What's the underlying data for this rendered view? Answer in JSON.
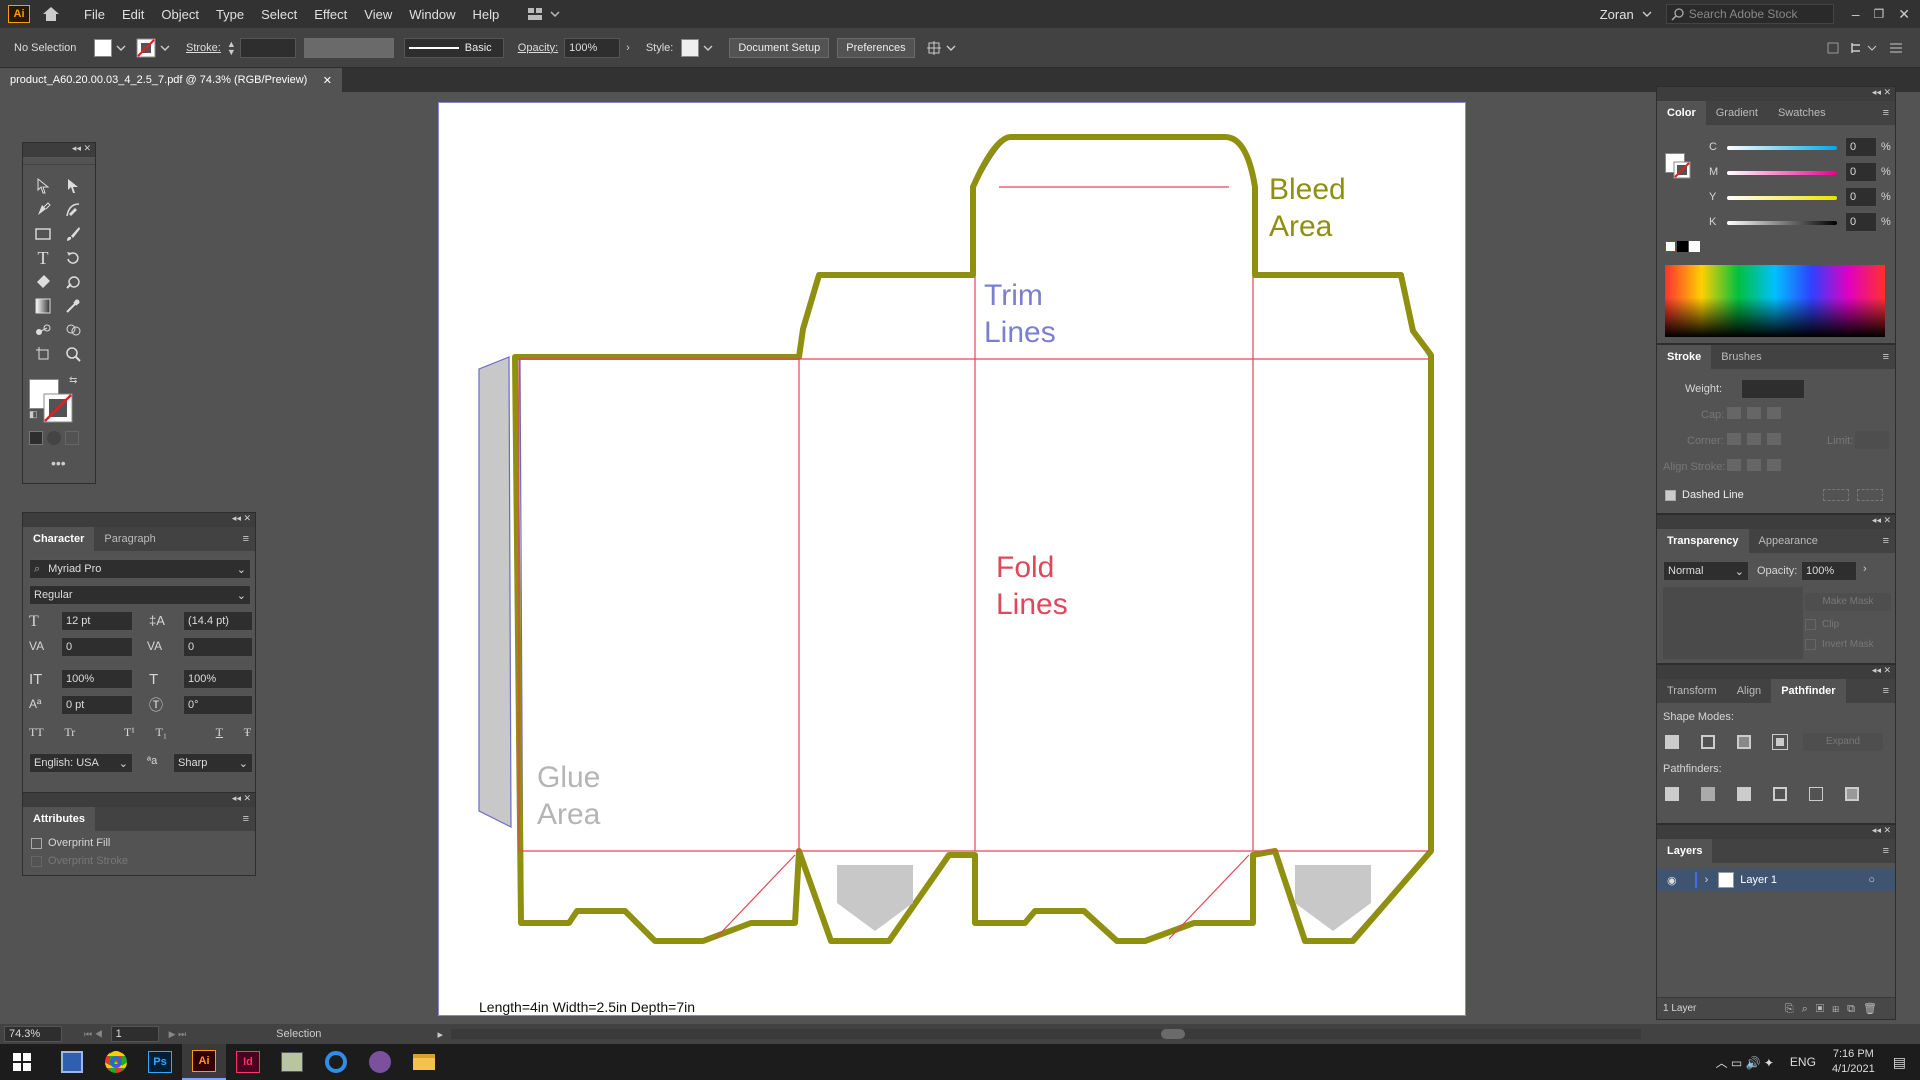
{
  "app": {
    "logo": "Ai",
    "user": "Zoran",
    "search_placeholder": "Search Adobe Stock"
  },
  "menu": [
    "File",
    "Edit",
    "Object",
    "Type",
    "Select",
    "Effect",
    "View",
    "Window",
    "Help"
  ],
  "control": {
    "selection": "No Selection",
    "stroke_label": "Stroke:",
    "brush": "Basic",
    "opacity_label": "Opacity:",
    "opacity": "100%",
    "style_label": "Style:",
    "doc_setup": "Document Setup",
    "preferences": "Preferences"
  },
  "document": {
    "tab_title": "product_A60.20.00.03_4_2.5_7.pdf @ 74.3% (RGB/Preview)"
  },
  "artboard": {
    "bleed_area": [
      "Bleed",
      "Area"
    ],
    "trim_lines": [
      "Trim",
      "Lines"
    ],
    "fold_lines": [
      "Fold",
      "Lines"
    ],
    "glue_area": [
      "Glue",
      "Area"
    ],
    "dimensions": "Length=4in Width=2.5in Depth=7in",
    "colors": {
      "bleed": "#8f8f10",
      "trim": "#7b7fd0",
      "fold": "#e0475a",
      "glue": "#b5b5b5"
    }
  },
  "character": {
    "tabs": [
      "Character",
      "Paragraph"
    ],
    "font": "Myriad Pro",
    "style": "Regular",
    "size": "12 pt",
    "leading": "(14.4 pt)",
    "kerning": "0",
    "tracking": "0",
    "vscale": "100%",
    "hscale": "100%",
    "baseline": "0 pt",
    "rotation": "0°",
    "language": "English: USA",
    "aa": "Sharp",
    "caps": [
      "TT",
      "Tr",
      "T¹",
      "T₁",
      "T",
      "Ŧ"
    ]
  },
  "attributes": {
    "title": "Attributes",
    "overprint_fill": "Overprint Fill",
    "overprint_stroke": "Overprint Stroke"
  },
  "color_panel": {
    "tabs": [
      "Color",
      "Gradient",
      "Swatches"
    ],
    "channels": [
      {
        "name": "C",
        "value": "0"
      },
      {
        "name": "M",
        "value": "0"
      },
      {
        "name": "Y",
        "value": "0"
      },
      {
        "name": "K",
        "value": "0"
      }
    ],
    "pct": "%"
  },
  "stroke_panel": {
    "tabs": [
      "Stroke",
      "Brushes"
    ],
    "weight": "Weight:",
    "cap": "Cap:",
    "corner": "Corner:",
    "limit": "Limit:",
    "align": "Align Stroke:",
    "dashed": "Dashed Line"
  },
  "transparency": {
    "tabs": [
      "Transparency",
      "Appearance"
    ],
    "mode": "Normal",
    "opacity_label": "Opacity:",
    "opacity": "100%",
    "make_mask": "Make Mask",
    "clip": "Clip",
    "invert": "Invert Mask"
  },
  "pathfinder": {
    "tabs": [
      "Transform",
      "Align",
      "Pathfinder"
    ],
    "shape_modes": "Shape Modes:",
    "expand": "Expand",
    "pathfinders": "Pathfinders:"
  },
  "layers": {
    "title": "Layers",
    "layer_name": "Layer 1",
    "count": "1 Layer"
  },
  "status": {
    "zoom": "74.3%",
    "page": "1",
    "tool": "Selection"
  },
  "taskbar": {
    "lang": "ENG",
    "time": "7:16 PM",
    "date": "4/1/2021"
  }
}
